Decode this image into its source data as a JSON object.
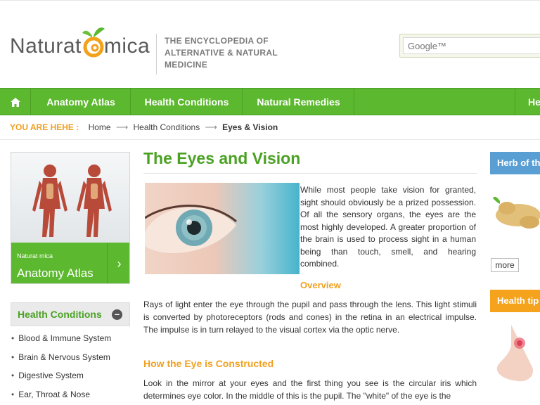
{
  "brand": {
    "logo_left": "Naturat",
    "logo_right": "mica",
    "tagline": "THE ENCYCLOPEDIA OF ALTERNATIVE & NATURAL MEDICINE"
  },
  "search": {
    "placeholder": "Google™"
  },
  "nav": {
    "items": [
      "Anatomy Atlas",
      "Health Conditions",
      "Natural Remedies",
      "He"
    ]
  },
  "breadcrumb": {
    "label": "YOU ARE HEHE :",
    "items": [
      "Home",
      "Health Conditions",
      "Eyes & Vision"
    ]
  },
  "sidebar": {
    "atlas_small": "Naturat mica",
    "atlas_title": "Anatomy Atlas",
    "health_title": "Health Conditions",
    "health_items": [
      "Blood & Immune System",
      "Brain & Nervous System",
      "Digestive System",
      "Ear, Throat & Nose"
    ]
  },
  "article": {
    "title": "The Eyes and Vision",
    "intro": "While most people take vision for granted, sight should obviously be a prized possession.  Of all the sensory organs, the eyes are the most highly developed.  A greater proportion of the brain is used to process sight in a human being than touch, smell, and hearing combined.",
    "overview_heading": "Overview",
    "paragraph1": "Rays of light enter the eye through the pupil and pass through the lens.  This light stimuli is converted by photoreceptors (rods and cones) in the retina in an electrical impulse.  The impulse is in turn relayed to the visual cortex via the optic nerve.",
    "constructed_heading": "How the Eye is Constructed",
    "paragraph2": "Look in the mirror at your eyes and the first thing you see is the circular iris which determines eye color.  In the middle of this is the pupil.  The \"white\" of the eye is the"
  },
  "right": {
    "herb_title": "Herb of th",
    "more_label": "more",
    "tips_title": "Health tip"
  },
  "colors": {
    "brand_green": "#5cb82e",
    "accent_orange": "#f0a020",
    "herb_blue": "#5a9fd4",
    "tips_orange": "#f5a31c"
  }
}
